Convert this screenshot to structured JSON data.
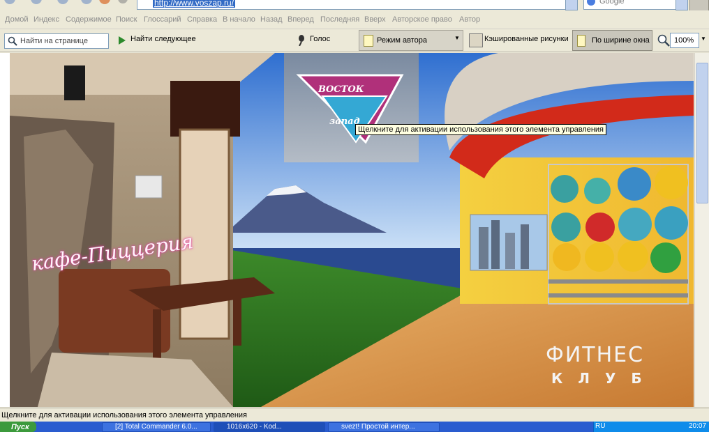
{
  "browser": {
    "address_url": "http://www.voszap.ru/",
    "search_engine": "Google"
  },
  "menu": {
    "items": [
      "Домой",
      "Индекс",
      "Содержимое",
      "Поиск",
      "Глоссарий",
      "Справка",
      "В начало",
      "Назад",
      "Вперед",
      "Последняя",
      "Вверх",
      "Авторское право",
      "Автор"
    ]
  },
  "toolbar": {
    "find_placeholder": "Найти на странице",
    "find_next_label": "Найти следующее",
    "voice_label": "Голос",
    "author_mode_label": "Режим автора",
    "cached_images_label": "Кэшированные рисунки",
    "fit_width_label": "По ширине окна",
    "zoom_value": "100%"
  },
  "page": {
    "logo_line1": "ВОСТОК",
    "logo_line2": "запад",
    "cafe_sign": "кафе-Пиццерия",
    "fitness_line1": "ФИТНЕС",
    "fitness_line2": "КЛУБ",
    "tooltip": "Щелкните для активации использования этого элемента управления"
  },
  "status_bar": {
    "text": "Щелкните для активации использования этого элемента управления"
  },
  "taskbar": {
    "start_label": "Пуск",
    "tasks": [
      "[2] Total Commander 6.0...",
      "1016x620 - Kod...",
      "svezt! Простой интер..."
    ],
    "tray_lang": "RU",
    "clock": "20:07"
  },
  "colors": {
    "accent_blue": "#316ac5",
    "taskbar_blue": "#2a5ccf",
    "logo_magenta": "#b0307a",
    "logo_cyan": "#34a8d4"
  }
}
